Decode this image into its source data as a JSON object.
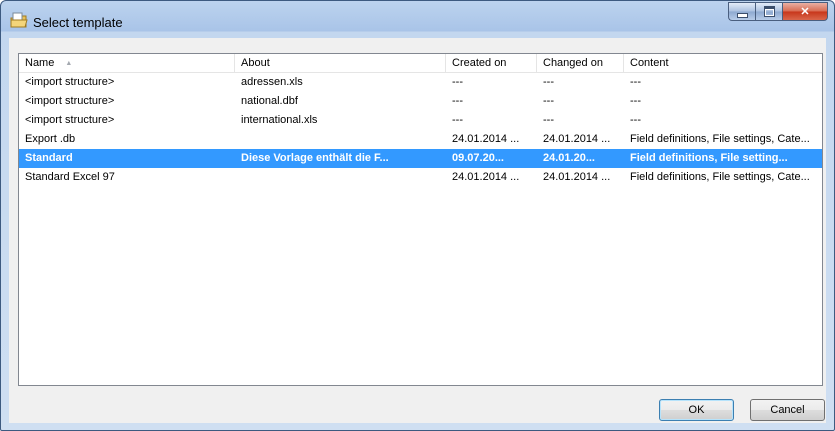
{
  "window": {
    "title": "Select template",
    "icon": "template-folder-icon"
  },
  "list": {
    "columns": [
      "Name",
      "About",
      "Created on",
      "Changed on",
      "Content"
    ],
    "sorted_column": "Name",
    "rows": [
      {
        "name": "<import structure>",
        "about": "adressen.xls",
        "created": "---",
        "changed": "---",
        "content": "---"
      },
      {
        "name": "<import structure>",
        "about": "national.dbf",
        "created": "---",
        "changed": "---",
        "content": "---"
      },
      {
        "name": "<import structure>",
        "about": "international.xls",
        "created": "---",
        "changed": "---",
        "content": "---"
      },
      {
        "name": "Export .db",
        "about": "",
        "created": "24.01.2014 ...",
        "changed": "24.01.2014 ...",
        "content": "Field definitions, File settings, Cate..."
      },
      {
        "name": "Standard",
        "about": "Diese Vorlage enthält die F...",
        "created": "09.07.20...",
        "changed": "24.01.20...",
        "content": "Field definitions, File setting..."
      },
      {
        "name": "Standard Excel 97",
        "about": "",
        "created": "24.01.2014 ...",
        "changed": "24.01.2014 ...",
        "content": "Field definitions, File settings, Cate..."
      }
    ],
    "selected_row": 4
  },
  "buttons": {
    "ok": "OK",
    "cancel": "Cancel"
  },
  "colors": {
    "selection": "#3399ff",
    "title_bar": "#a9c4e8"
  }
}
